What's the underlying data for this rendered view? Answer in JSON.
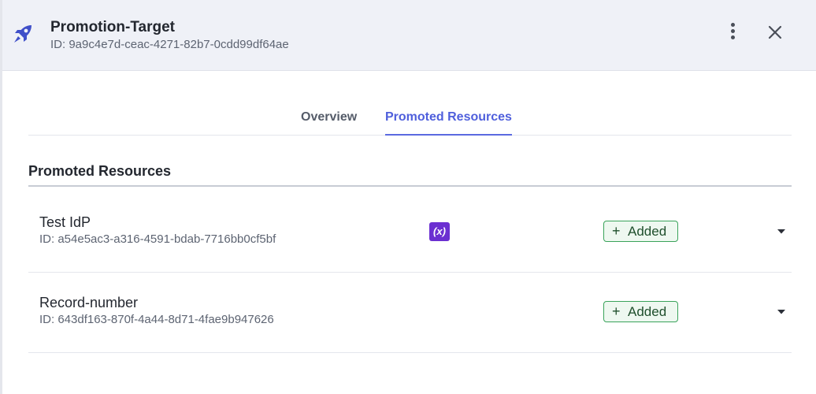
{
  "header": {
    "title": "Promotion-Target",
    "id_text": "ID: 9a9c4e7d-ceac-4271-82b7-0cdd99df64ae",
    "icon": "rocket-icon"
  },
  "tabs": [
    {
      "label": "Overview",
      "active": false
    },
    {
      "label": "Promoted Resources",
      "active": true
    }
  ],
  "section": {
    "title": "Promoted Resources"
  },
  "resources": [
    {
      "name": "Test IdP",
      "id_text": "ID: a54e5ac3-a316-4591-bdab-7716bb0cf5bf",
      "variable_badge": "(x)",
      "status_plus": "+",
      "status": "Added"
    },
    {
      "name": "Record-number",
      "id_text": "ID: 643df163-870f-4a44-8d71-4fae9b947626",
      "status_plus": "+",
      "status": "Added"
    }
  ],
  "colors": {
    "accent": "#4f5fdc",
    "header_bg": "#eff1f7",
    "added_border": "#3aa35a",
    "variable_badge": "#6b2fd1"
  }
}
